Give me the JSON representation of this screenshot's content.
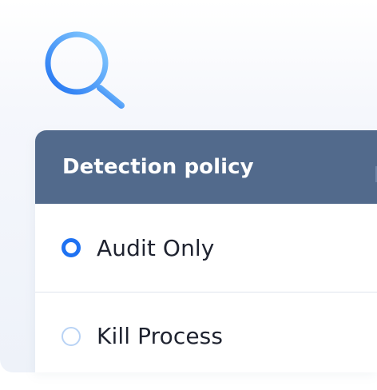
{
  "icons": {
    "search": "search-icon"
  },
  "colors": {
    "header_bg": "#526a8c",
    "radio_accent": "#1f72f2",
    "radio_inactive": "#b9d3f5",
    "icon_gradient_start": "#8fd2ff",
    "icon_gradient_end": "#1f72f2"
  },
  "policy": {
    "title": "Detection policy",
    "options": [
      {
        "label": "Audit Only",
        "selected": true
      },
      {
        "label": "Kill Process",
        "selected": false
      }
    ]
  }
}
